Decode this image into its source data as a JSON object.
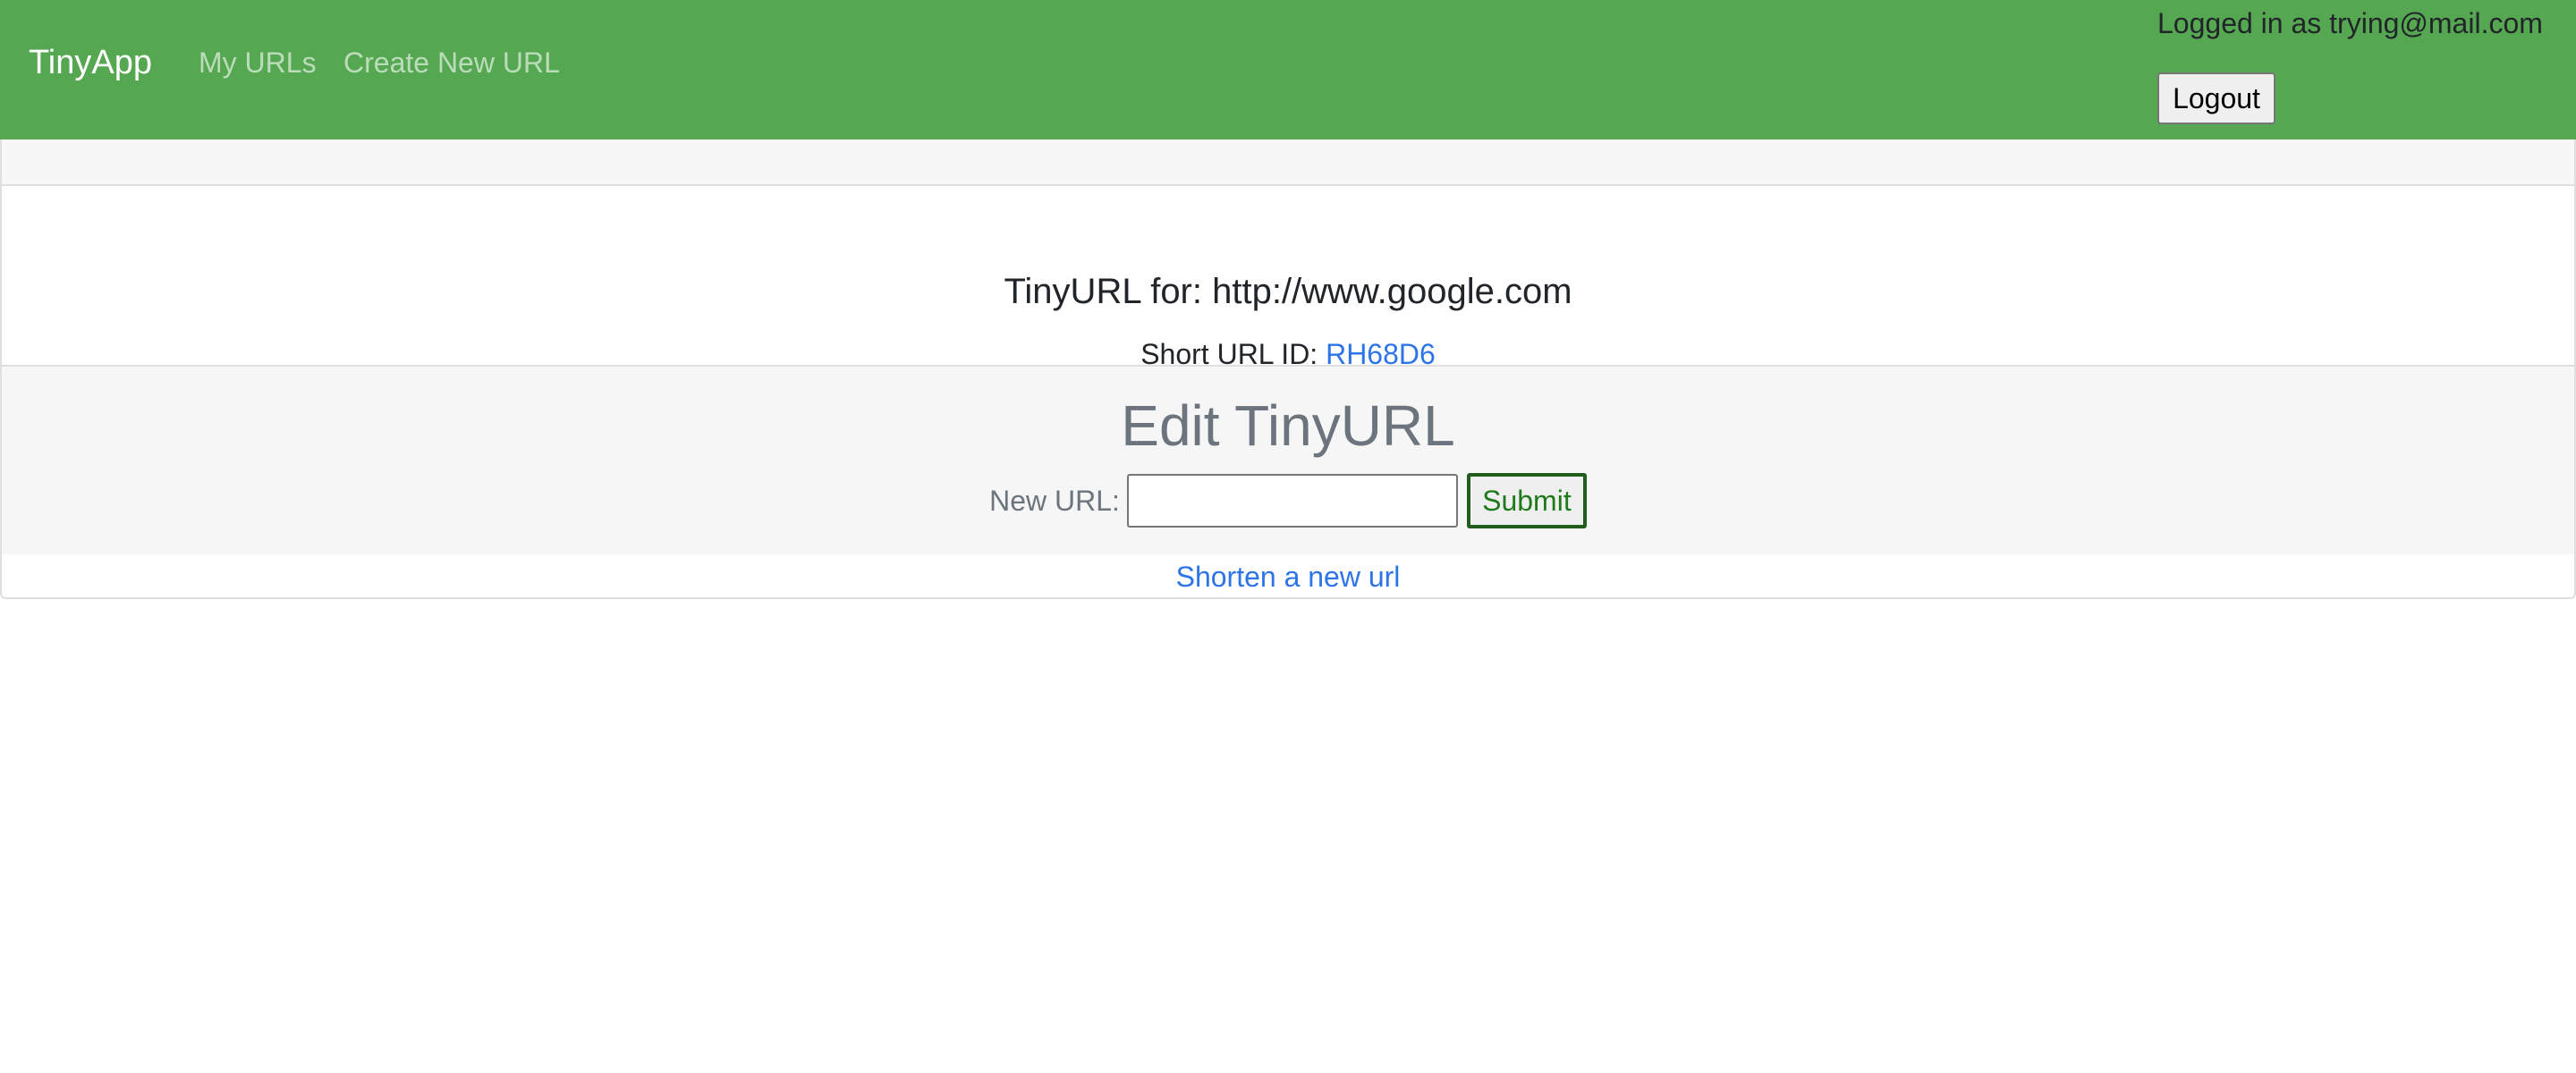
{
  "navbar": {
    "brand": "TinyApp",
    "links": [
      "My URLs",
      "Create New URL"
    ],
    "user_text": "Logged in as trying@mail.com",
    "logout_label": "Logout",
    "background_color": "#55a752"
  },
  "card": {
    "title": "TinyURL for: http://www.google.com",
    "short_id_label": "Short URL ID: ",
    "short_id_value": "RH68D6",
    "edit": {
      "heading": "Edit TinyURL",
      "new_url_label": "New URL:",
      "new_url_value": "",
      "submit_label": "Submit"
    },
    "footer_link": "Shorten a new url"
  },
  "colors": {
    "link": "#2d74e8",
    "muted_text": "#6c757d",
    "submit_text": "#1f7a1c"
  }
}
